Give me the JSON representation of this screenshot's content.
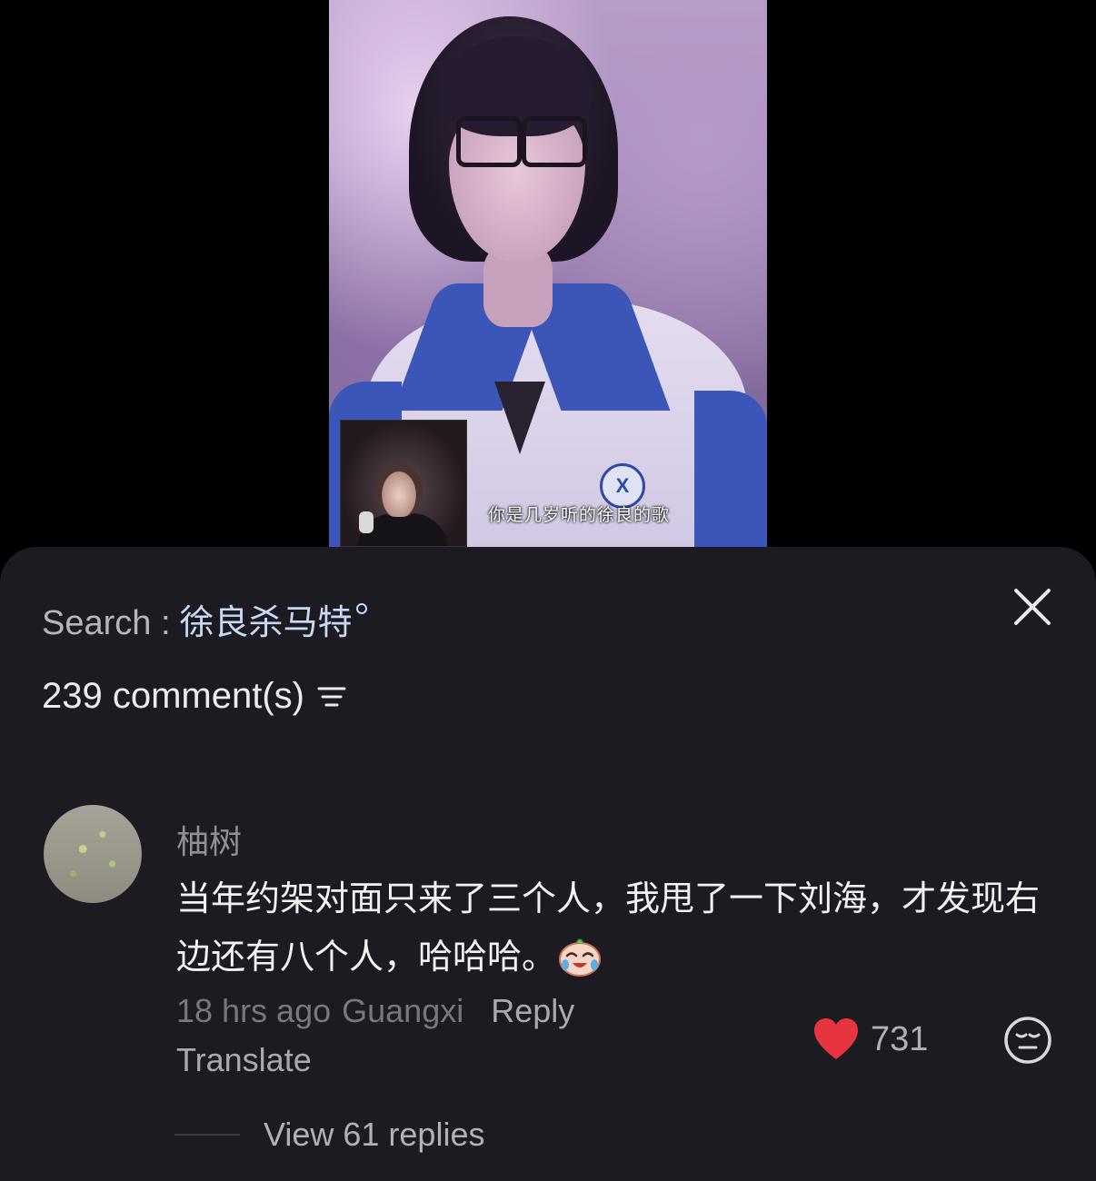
{
  "video": {
    "subtitle": "你是几岁听的徐良的歌",
    "badge_text": "X"
  },
  "search": {
    "prefix": "Search :",
    "term": "徐良杀马特"
  },
  "comments_header": {
    "count_label": "239 comment(s)"
  },
  "comment": {
    "username": "柚树",
    "text": "当年约架对面只来了三个人，我甩了一下刘海，才发现右边还有八个人，哈哈哈。",
    "time": "18 hrs ago",
    "location": "Guangxi",
    "reply_label": "Reply",
    "translate_label": "Translate",
    "likes": "731",
    "view_replies_label": "View 61 replies"
  },
  "colors": {
    "sheet_bg": "#1c1b22",
    "heart": "#e8343e",
    "search_term": "#c9d8f5"
  },
  "icons": [
    "close-icon",
    "sort-icon",
    "heart-icon",
    "reaction-icon",
    "search-glyph-icon",
    "laughing-emoji-icon"
  ]
}
